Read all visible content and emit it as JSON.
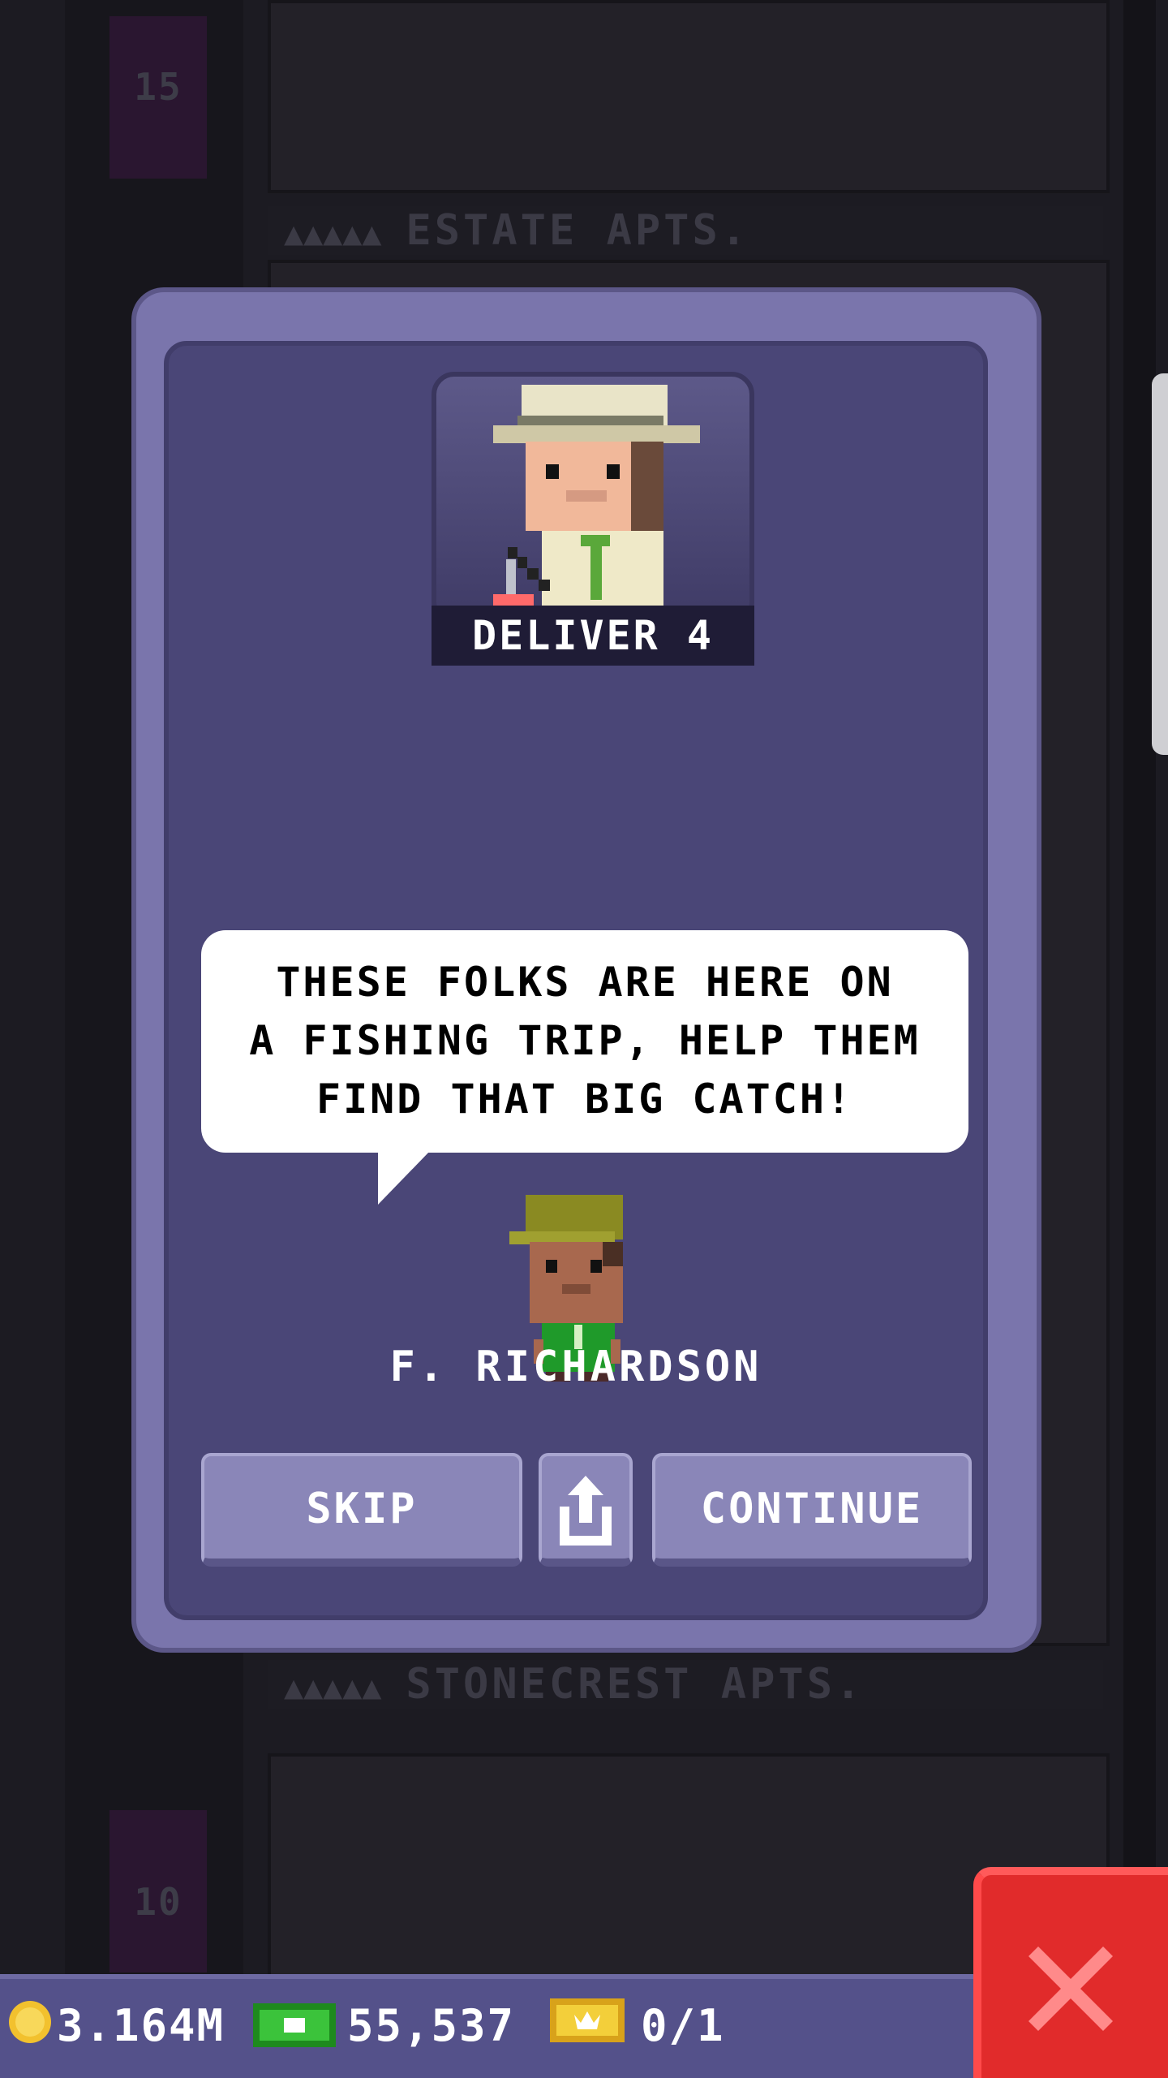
{
  "background": {
    "floor_numbers": [
      "15",
      "10"
    ],
    "signs": [
      "ESTATE APTS.",
      "STONECREST APTS."
    ]
  },
  "mission": {
    "portrait_label": "DELIVER 4",
    "speech": [
      "THESE FOLKS ARE HERE ON",
      "A FISHING TRIP, HELP THEM",
      "FIND THAT BIG CATCH!"
    ],
    "speaker_name": "F. RICHARDSON"
  },
  "buttons": {
    "skip": "SKIP",
    "continue": "CONTINUE"
  },
  "status_bar": {
    "coins": "3.164M",
    "bux": "55,537",
    "vip": "0/1"
  },
  "icons": {
    "coin": "coin-icon",
    "bux": "bux-icon",
    "vip": "golden-ticket-icon",
    "share": "share-icon",
    "close": "close-icon"
  },
  "colors": {
    "modal_frame": "#7a75ac",
    "modal_inner": "#4a4677",
    "button": "#8a86b8",
    "close_button": "#e12b2b",
    "bottom_bar": "#54518a"
  }
}
